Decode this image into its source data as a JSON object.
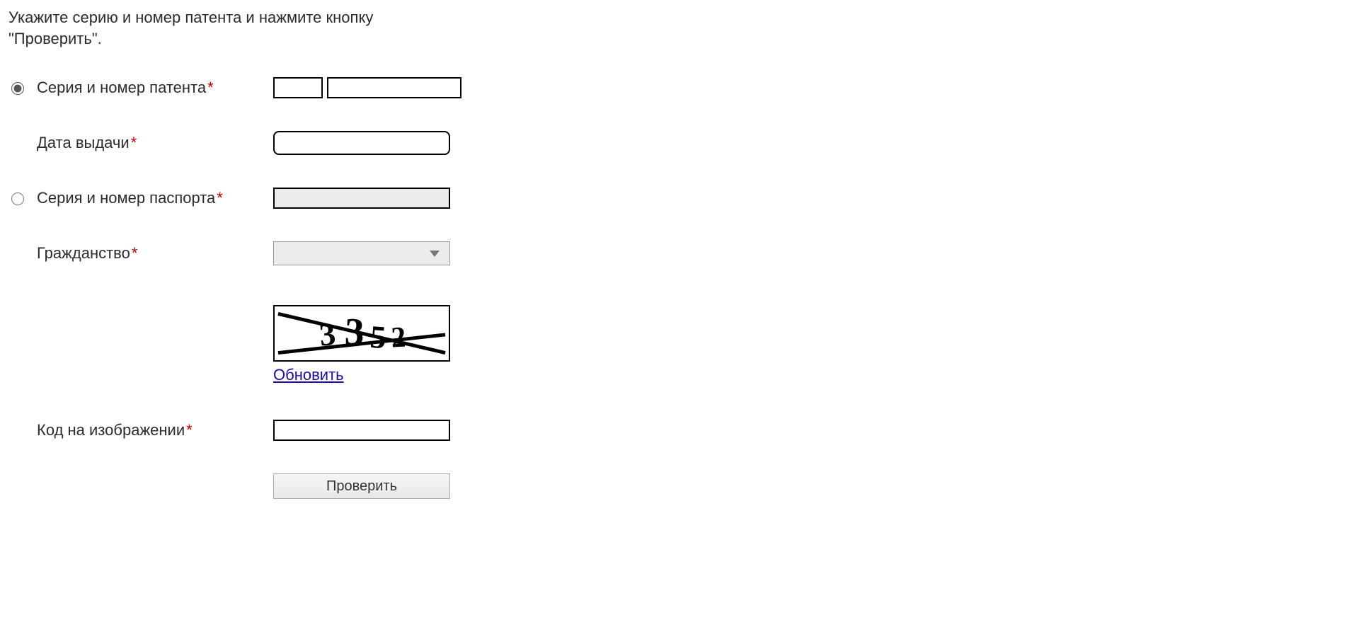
{
  "instructions": "Укажите серию и номер патента и нажмите кнопку \"Проверить\".",
  "form": {
    "patent": {
      "label": "Серия и номер патента",
      "required_mark": "*",
      "series_value": "",
      "number_value": ""
    },
    "issue_date": {
      "label": "Дата выдачи",
      "required_mark": "*",
      "value": ""
    },
    "passport": {
      "label": "Серия и номер паспорта",
      "required_mark": "*",
      "value": ""
    },
    "citizenship": {
      "label": "Гражданство",
      "required_mark": "*",
      "selected": ""
    },
    "captcha": {
      "image_text": "3352",
      "refresh_label": "Обновить",
      "input_label": "Код на изображении",
      "required_mark": "*",
      "value": ""
    },
    "submit_label": "Проверить"
  }
}
